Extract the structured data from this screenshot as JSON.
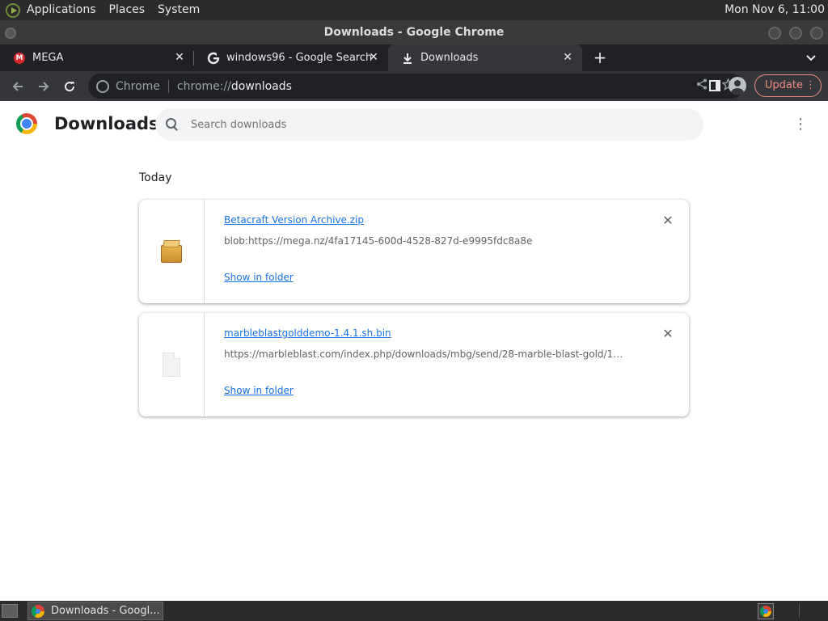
{
  "desktop": {
    "menus": [
      "Applications",
      "Places",
      "System"
    ],
    "clock": "Mon Nov 6, 11:00"
  },
  "window": {
    "title": "Downloads - Google Chrome"
  },
  "tabs": [
    {
      "label": "MEGA",
      "icon": "mega-icon"
    },
    {
      "label": "windows96 - Google Search",
      "icon": "google-icon"
    },
    {
      "label": "Downloads",
      "icon": "download-icon",
      "active": true
    }
  ],
  "toolbar": {
    "scheme_label": "Chrome",
    "url_host": "chrome://",
    "url_path": "downloads",
    "update_label": "Update"
  },
  "page": {
    "title": "Downloads",
    "search_placeholder": "Search downloads",
    "section_label": "Today"
  },
  "downloads": [
    {
      "name": "Betacraft Version Archive.zip",
      "url": "blob:https://mega.nz/4fa17145-600d-4528-827d-e9995fdc8a8e",
      "action": "Show in folder",
      "icon": "zip-archive-icon"
    },
    {
      "name": "marbleblastgolddemo-1.4.1.sh.bin",
      "url": "https://marbleblast.com/index.php/downloads/mbg/send/28-marble-blast-gold/13-...",
      "action": "Show in folder",
      "icon": "generic-file-icon"
    }
  ],
  "taskbar": {
    "task_label": "Downloads - Googl..."
  },
  "colors": {
    "link": "#1a73e8",
    "toolbar_bg": "#35363a",
    "tabstrip_bg": "#202124",
    "update_accent": "#f28b82"
  }
}
